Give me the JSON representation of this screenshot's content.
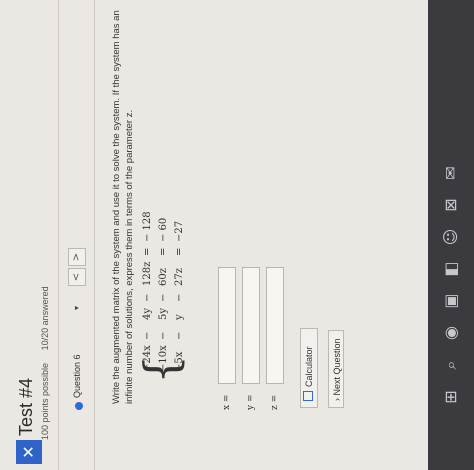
{
  "header": {
    "title": "Test #4",
    "points_possible": "100 points possible",
    "answered": "10/20 answered",
    "close_glyph": "✕"
  },
  "question_nav": {
    "label": "Question 6",
    "caret": "▾",
    "prev": "<",
    "next": ">"
  },
  "question": {
    "instructions": "Write the augmented matrix of the system and use it to solve the system. If the system has an infinite number of solutions, express them in terms of the parameter z.",
    "equations": [
      {
        "t1": "−24x",
        "op1": "−",
        "t2": "4y",
        "op2": "−",
        "t3": "128z",
        "eq": "=",
        "rhs": "− 128"
      },
      {
        "t1": "−10x",
        "op1": "−",
        "t2": "5y",
        "op2": "−",
        "t3": "60z",
        "eq": "=",
        "rhs": "− 60"
      },
      {
        "t1": "−5x",
        "op1": "−",
        "t2": "y",
        "op2": "−",
        "t3": "27z",
        "eq": "=",
        "rhs": "−27"
      }
    ],
    "answers": [
      {
        "label": "x =",
        "value": ""
      },
      {
        "label": "y =",
        "value": ""
      },
      {
        "label": "z =",
        "value": ""
      }
    ]
  },
  "buttons": {
    "calculator": "Calculator",
    "next_question": "› Next Question"
  },
  "taskbar": {
    "icons": [
      "windows-icon",
      "search-icon",
      "task-view-icon",
      "browser-icon",
      "files-icon",
      "people-icon",
      "store-icon",
      "mail-icon"
    ]
  }
}
